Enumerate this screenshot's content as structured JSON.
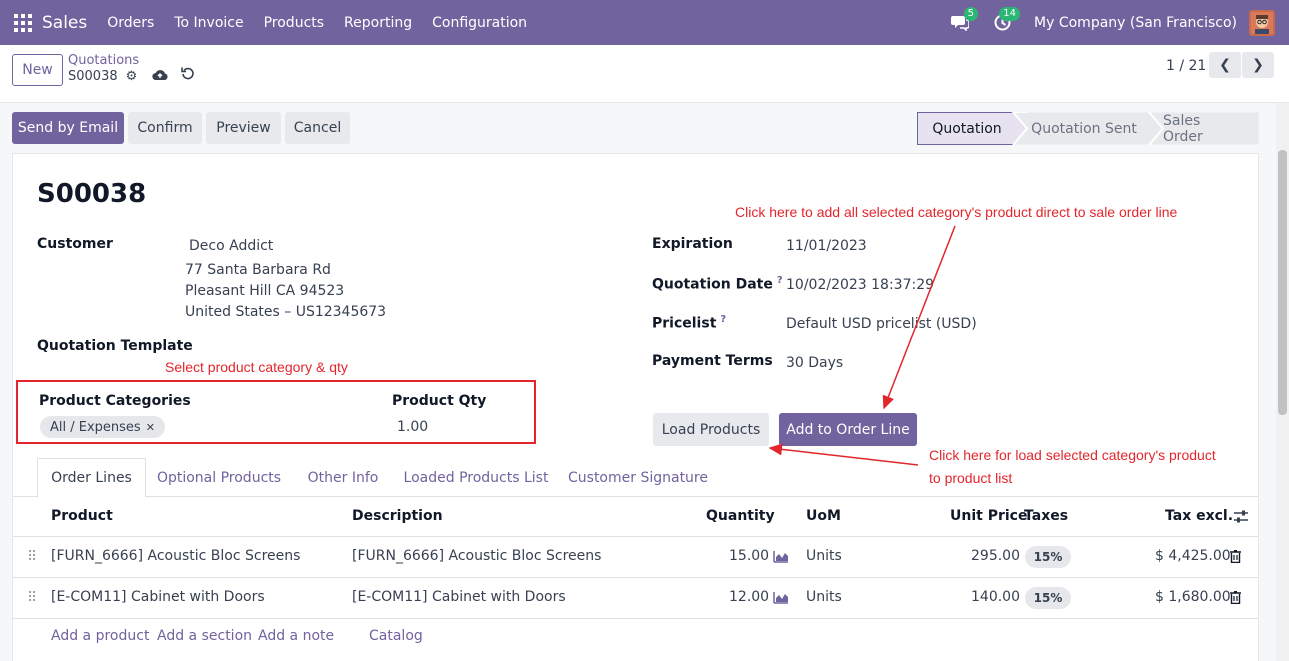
{
  "topbar": {
    "app_name": "Sales",
    "menu": [
      "Orders",
      "To Invoice",
      "Products",
      "Reporting",
      "Configuration"
    ],
    "messages_count": "5",
    "activities_count": "14",
    "company": "My Company (San Francisco)",
    "accent_color": "#71639e"
  },
  "control": {
    "new_label": "New",
    "breadcrumb_parent": "Quotations",
    "breadcrumb_current": "S00038",
    "pager": "1 / 21"
  },
  "actions": {
    "send_email": "Send by Email",
    "confirm": "Confirm",
    "preview": "Preview",
    "cancel": "Cancel"
  },
  "status": {
    "stages": [
      "Quotation",
      "Quotation Sent",
      "Sales Order"
    ],
    "current": "Quotation"
  },
  "form": {
    "title": "S00038",
    "customer_label": "Customer",
    "customer_name": "Deco Addict",
    "address_line1": "77 Santa Barbara Rd",
    "address_line2": "Pleasant Hill CA 94523",
    "address_line3": "United States – US12345673",
    "template_label": "Quotation Template",
    "categories_label": "Product Categories",
    "category_tag": "All / Expenses",
    "qty_label": "Product Qty",
    "qty_value": "1.00",
    "expiration_label": "Expiration",
    "expiration_value": "11/01/2023",
    "qdate_label": "Quotation Date",
    "qdate_value": "10/02/2023 18:37:29",
    "pricelist_label": "Pricelist",
    "pricelist_value": "Default USD pricelist (USD)",
    "terms_label": "Payment Terms",
    "terms_value": "30 Days",
    "help_mark": "?",
    "load_products": "Load Products",
    "add_to_order": "Add to Order Line"
  },
  "annotations": {
    "select_category": "Select product category & qty",
    "add_all": "Click here to add all selected category's product direct to sale order line",
    "load_line1": "Click here for load selected category's product",
    "load_line2": "to product list"
  },
  "tabs": [
    "Order Lines",
    "Optional Products",
    "Other Info",
    "Loaded Products List",
    "Customer Signature"
  ],
  "table": {
    "headers": {
      "product": "Product",
      "description": "Description",
      "quantity": "Quantity",
      "uom": "UoM",
      "unit_price": "Unit Price",
      "taxes": "Taxes",
      "tax_excl": "Tax excl."
    },
    "rows": [
      {
        "product": "[FURN_6666] Acoustic Bloc Screens",
        "description": "[FURN_6666] Acoustic Bloc Screens",
        "quantity": "15.00",
        "uom": "Units",
        "unit_price": "295.00",
        "tax": "15%",
        "subtotal": "$ 4,425.00"
      },
      {
        "product": "[E-COM11] Cabinet with Doors",
        "description": "[E-COM11] Cabinet with Doors",
        "quantity": "12.00",
        "uom": "Units",
        "unit_price": "140.00",
        "tax": "15%",
        "subtotal": "$ 1,680.00"
      }
    ],
    "add_product": "Add a product",
    "add_section": "Add a section",
    "add_note": "Add a note",
    "catalog": "Catalog"
  }
}
